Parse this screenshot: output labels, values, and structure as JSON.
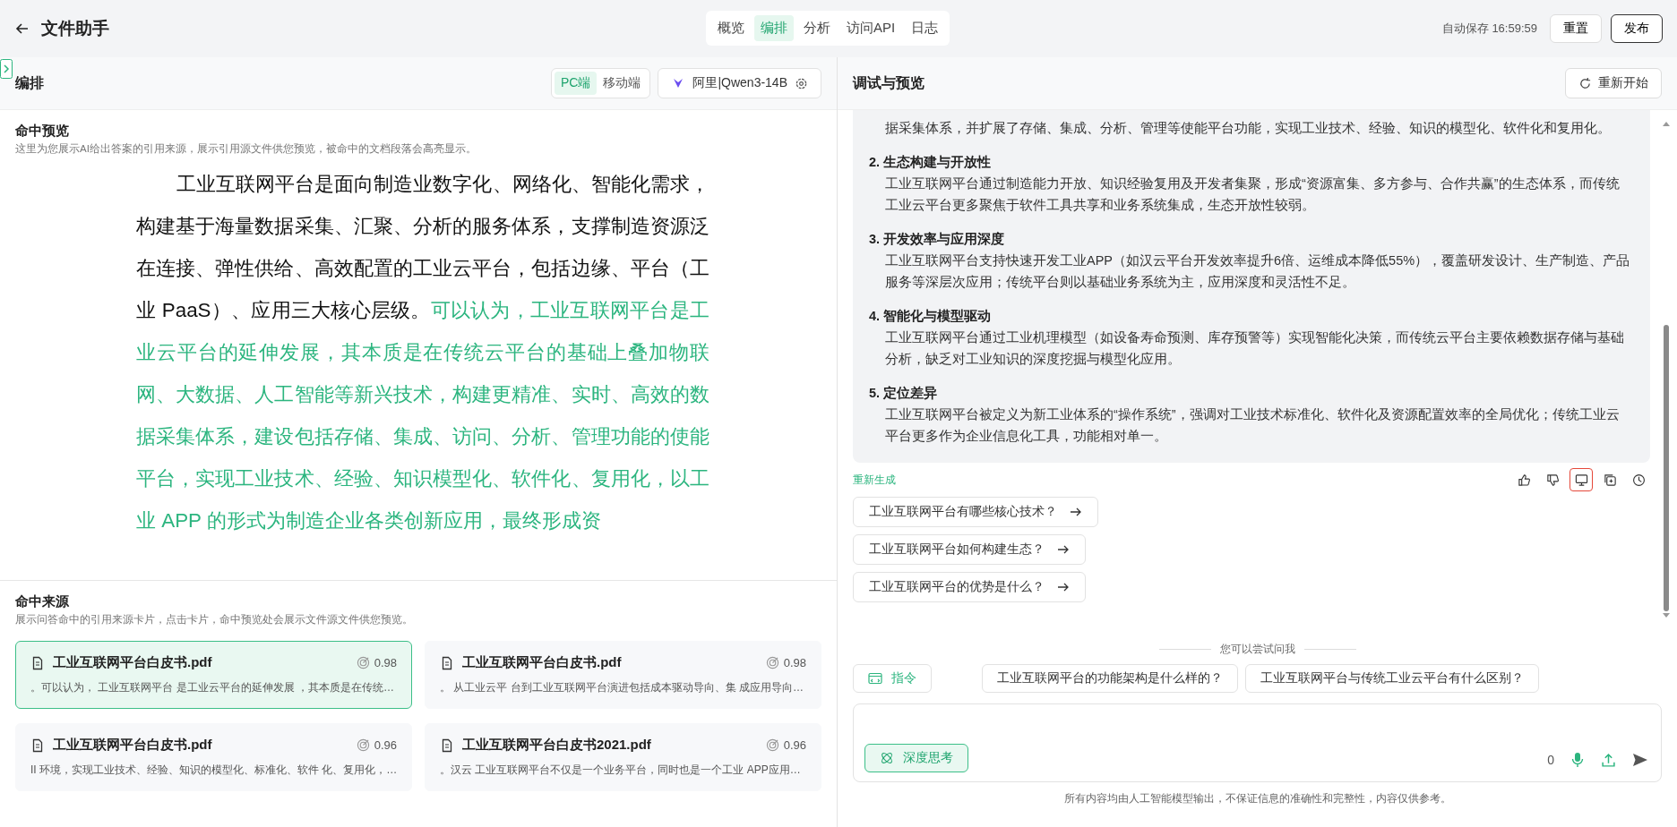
{
  "header": {
    "title": "文件助手",
    "tabs": [
      {
        "label": "概览",
        "selected": false
      },
      {
        "label": "编排",
        "selected": true
      },
      {
        "label": "分析",
        "selected": false
      },
      {
        "label": "访问API",
        "selected": false
      },
      {
        "label": "日志",
        "selected": false
      }
    ],
    "autosave": "自动保存 16:59:59",
    "buttons": [
      {
        "label": "重置",
        "kind": "secondary"
      },
      {
        "label": "发布",
        "kind": "primary"
      }
    ]
  },
  "editor": {
    "title": "编排",
    "device_tabs": [
      {
        "label": "PC端",
        "selected": true
      },
      {
        "label": "移动端",
        "selected": false
      }
    ],
    "model": "阿里|Qwen3-14B",
    "preview": {
      "title": "命中预览",
      "description": "这里为您展示AI给出答案的引用来源，展示引用源文件供您预览，被命中的文档段落会高亮显示。",
      "document": [
        {
          "text": "工业互联网平台是面向制造业数字化、网络化、智能化需求，构建基于海量数据采集、汇聚、分析的服务体系，支撑制造资源泛在连接、弹性供给、高效配置的工业云平台，包括边缘、平台（工业 PaaS）、应用三大核心层级。",
          "highlighted": false
        },
        {
          "text": "可以认为，工业互联网平台是工业云平台的延伸发展，其本质是在传统云平台的基础上叠加物联网、大数据、人工智能等新兴技术，构建更精准、实时、高效的数据采集体系，建设包括存储、集成、访问、分析、管理功能的使能平台，实现工业技术、经验、知识模型化、软件化、复用化，以工业 APP 的形式为制造企业各类创新应用，最终形成资",
          "highlighted": true
        }
      ]
    },
    "sources": {
      "title": "命中来源",
      "description": "展示问答命中的引用来源卡片，点击卡片，命中预览处会展示文件源文件供您预览。",
      "cards": [
        {
          "file": "工业互联网平台白皮书.pdf",
          "score": "0.98",
          "snippet": "。可以认为， 工业互联网平台 是工业云平台的延伸发展 ，其本质是在传统…",
          "selected": true
        },
        {
          "file": "工业互联网平台白皮书.pdf",
          "score": "0.98",
          "snippet": "。 从工业云平 台到工业互联网平台演进包括成本驱动导向、集 成应用导向…",
          "selected": false
        },
        {
          "file": "工业互联网平台白皮书.pdf",
          "score": "0.96",
          "snippet": "II 环境，实现工业技术、经验、知识的模型化、标准化、软件 化、复用化，…",
          "selected": false
        },
        {
          "file": "工业互联网平台白皮书2021.pdf",
          "score": "0.96",
          "snippet": "。汉云 工业互联网平台不仅是一个业务平台，同时也是一个工业 APP应用…",
          "selected": false
        }
      ]
    }
  },
  "debug": {
    "title": "调试与预览",
    "restart": "重新开始",
    "answer": {
      "lead": "据采集体系，并扩展了存储、集成、分析、管理等使能平台功能，实现工业技术、经验、知识的模型化、软件化和复用化。",
      "items": [
        {
          "number": "2.",
          "heading": "生态构建与开放性",
          "text": "工业互联网平台通过制造能力开放、知识经验复用及开发者集聚，形成“资源富集、多方参与、合作共赢”的生态体系，而传统工业云平台更多聚焦于软件工具共享和业务系统集成，生态开放性较弱。"
        },
        {
          "number": "3.",
          "heading": "开发效率与应用深度",
          "text": "工业互联网平台支持快速开发工业APP（如汉云平台开发效率提升6倍、运维成本降低55%），覆盖研发设计、生产制造、产品服务等深层次应用；传统平台则以基础业务系统为主，应用深度和灵活性不足。"
        },
        {
          "number": "4.",
          "heading": "智能化与模型驱动",
          "text": "工业互联网平台通过工业机理模型（如设备寿命预测、库存预警等）实现智能化决策，而传统云平台主要依赖数据存储与基础分析，缺乏对工业知识的深度挖掘与模型化应用。"
        },
        {
          "number": "5.",
          "heading": "定位差异",
          "text": "工业互联网平台被定义为新工业体系的“操作系统”，强调对工业技术标准化、软件化及资源配置效率的全局优化；传统工业云平台更多作为企业信息化工具，功能相对单一。"
        }
      ]
    },
    "regenerate": "重新生成",
    "actions": [
      {
        "kind": "like",
        "selected": false
      },
      {
        "kind": "dislike",
        "selected": false
      },
      {
        "kind": "monitor",
        "selected": true
      },
      {
        "kind": "copy",
        "selected": false
      },
      {
        "kind": "history",
        "selected": false
      }
    ],
    "follow_ups": [
      "工业互联网平台有哪些核心技术？",
      "工业互联网平台如何构建生态？",
      "工业互联网平台的优势是什么？"
    ],
    "try_label": "您可以尝试问我",
    "command": "指令",
    "suggestions": [
      "工业互联网平台的功能架构是什么样的？",
      "工业互联网平台与传统工业云平台有什么区别？"
    ],
    "input": {
      "count": "0",
      "deep_think": {
        "label": "深度思考",
        "on": true
      }
    },
    "disclaimer": "所有内容均由人工智能模型输出，不保证信息的准确性和完整性，内容仅供参考。"
  }
}
